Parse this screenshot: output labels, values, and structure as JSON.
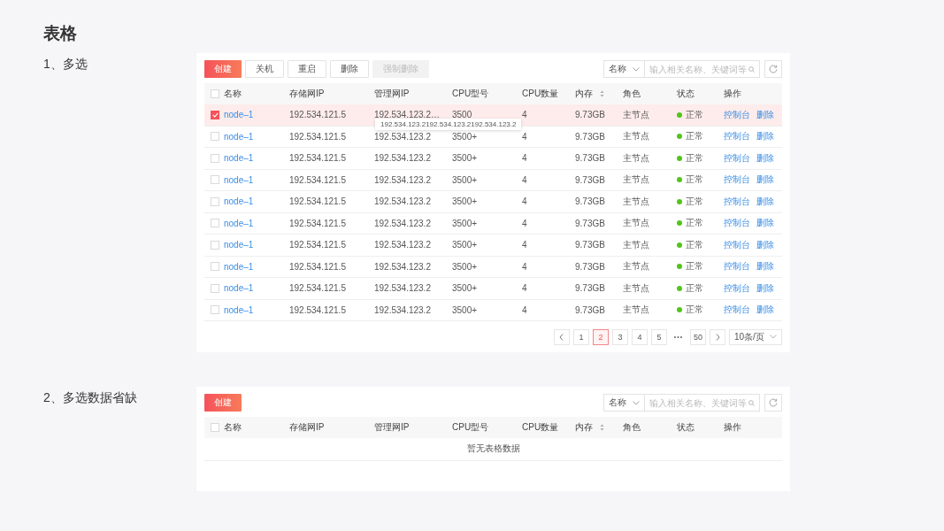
{
  "page_title": "表格",
  "sections": [
    {
      "heading": "1、多选",
      "toolbar": {
        "buttons": [
          {
            "label": "创建",
            "kind": "primary",
            "disabled": false
          },
          {
            "label": "关机",
            "kind": "default",
            "disabled": false
          },
          {
            "label": "重启",
            "kind": "default",
            "disabled": false
          },
          {
            "label": "删除",
            "kind": "default",
            "disabled": false
          },
          {
            "label": "强制删除",
            "kind": "default",
            "disabled": true
          }
        ],
        "filter_select": "名称",
        "search": {
          "placeholder": "输入相关名称、关键词等"
        }
      },
      "table": {
        "header_checked": false,
        "columns": [
          {
            "label": "名称",
            "sortable": false
          },
          {
            "label": "存储网IP",
            "sortable": false
          },
          {
            "label": "管理网IP",
            "sortable": false
          },
          {
            "label": "CPU型号",
            "sortable": false
          },
          {
            "label": "CPU数量",
            "sortable": false
          },
          {
            "label": "内存",
            "sortable": true
          },
          {
            "label": "角色",
            "sortable": false
          },
          {
            "label": "状态",
            "sortable": false
          },
          {
            "label": "操作",
            "sortable": false
          }
        ],
        "rows": [
          {
            "selected": true,
            "name": "node–1",
            "storage_ip": "192.534.121.5",
            "mgmt_ip": "192.534.123.2…",
            "cpu_model": "3500",
            "cpu_count": "4",
            "memory": "9.73GB",
            "role": "主节点",
            "status": {
              "label": "正常",
              "color": "#52c41a"
            },
            "actions": [
              "控制台",
              "删除"
            ],
            "tooltip": "192.534.123.2192.534.123.2192.534.123.2"
          },
          {
            "selected": false,
            "name": "node–1",
            "storage_ip": "192.534.121.5",
            "mgmt_ip": "192.534.123.2",
            "cpu_model": "3500+",
            "cpu_count": "4",
            "memory": "9.73GB",
            "role": "主节点",
            "status": {
              "label": "正常",
              "color": "#52c41a"
            },
            "actions": [
              "控制台",
              "删除"
            ]
          },
          {
            "selected": false,
            "name": "node–1",
            "storage_ip": "192.534.121.5",
            "mgmt_ip": "192.534.123.2",
            "cpu_model": "3500+",
            "cpu_count": "4",
            "memory": "9.73GB",
            "role": "主节点",
            "status": {
              "label": "正常",
              "color": "#52c41a"
            },
            "actions": [
              "控制台",
              "删除"
            ]
          },
          {
            "selected": false,
            "name": "node–1",
            "storage_ip": "192.534.121.5",
            "mgmt_ip": "192.534.123.2",
            "cpu_model": "3500+",
            "cpu_count": "4",
            "memory": "9.73GB",
            "role": "主节点",
            "status": {
              "label": "正常",
              "color": "#52c41a"
            },
            "actions": [
              "控制台",
              "删除"
            ]
          },
          {
            "selected": false,
            "name": "node–1",
            "storage_ip": "192.534.121.5",
            "mgmt_ip": "192.534.123.2",
            "cpu_model": "3500+",
            "cpu_count": "4",
            "memory": "9.73GB",
            "role": "主节点",
            "status": {
              "label": "正常",
              "color": "#52c41a"
            },
            "actions": [
              "控制台",
              "删除"
            ]
          },
          {
            "selected": false,
            "name": "node–1",
            "storage_ip": "192.534.121.5",
            "mgmt_ip": "192.534.123.2",
            "cpu_model": "3500+",
            "cpu_count": "4",
            "memory": "9.73GB",
            "role": "主节点",
            "status": {
              "label": "正常",
              "color": "#52c41a"
            },
            "actions": [
              "控制台",
              "删除"
            ]
          },
          {
            "selected": false,
            "name": "node–1",
            "storage_ip": "192.534.121.5",
            "mgmt_ip": "192.534.123.2",
            "cpu_model": "3500+",
            "cpu_count": "4",
            "memory": "9.73GB",
            "role": "主节点",
            "status": {
              "label": "正常",
              "color": "#52c41a"
            },
            "actions": [
              "控制台",
              "删除"
            ]
          },
          {
            "selected": false,
            "name": "node–1",
            "storage_ip": "192.534.121.5",
            "mgmt_ip": "192.534.123.2",
            "cpu_model": "3500+",
            "cpu_count": "4",
            "memory": "9.73GB",
            "role": "主节点",
            "status": {
              "label": "正常",
              "color": "#52c41a"
            },
            "actions": [
              "控制台",
              "删除"
            ]
          },
          {
            "selected": false,
            "name": "node–1",
            "storage_ip": "192.534.121.5",
            "mgmt_ip": "192.534.123.2",
            "cpu_model": "3500+",
            "cpu_count": "4",
            "memory": "9.73GB",
            "role": "主节点",
            "status": {
              "label": "正常",
              "color": "#52c41a"
            },
            "actions": [
              "控制台",
              "删除"
            ]
          },
          {
            "selected": false,
            "name": "node–1",
            "storage_ip": "192.534.121.5",
            "mgmt_ip": "192.534.123.2",
            "cpu_model": "3500+",
            "cpu_count": "4",
            "memory": "9.73GB",
            "role": "主节点",
            "status": {
              "label": "正常",
              "color": "#52c41a"
            },
            "actions": [
              "控制台",
              "删除"
            ]
          }
        ],
        "pagination": {
          "pages": [
            {
              "label": "1",
              "selected": false
            },
            {
              "label": "2",
              "selected": true
            },
            {
              "label": "3",
              "selected": false
            },
            {
              "label": "4",
              "selected": false
            },
            {
              "label": "5",
              "selected": false
            },
            {
              "label": "•••",
              "kind": "ellipsis"
            },
            {
              "label": "50",
              "selected": false
            }
          ],
          "page_size": "10条/页"
        }
      }
    },
    {
      "heading": "2、多选数据省缺",
      "toolbar": {
        "buttons": [
          {
            "label": "创建",
            "kind": "primary",
            "disabled": false
          }
        ],
        "filter_select": "名称",
        "search": {
          "placeholder": "输入相关名称、关键词等"
        }
      },
      "table": {
        "header_checked": false,
        "columns": [
          {
            "label": "名称",
            "sortable": false
          },
          {
            "label": "存储网IP",
            "sortable": false
          },
          {
            "label": "管理网IP",
            "sortable": false
          },
          {
            "label": "CPU型号",
            "sortable": false
          },
          {
            "label": "CPU数量",
            "sortable": false
          },
          {
            "label": "内存",
            "sortable": true
          },
          {
            "label": "角色",
            "sortable": false
          },
          {
            "label": "状态",
            "sortable": false
          },
          {
            "label": "操作",
            "sortable": false
          }
        ],
        "empty_text": "暂无表格数据"
      }
    }
  ]
}
